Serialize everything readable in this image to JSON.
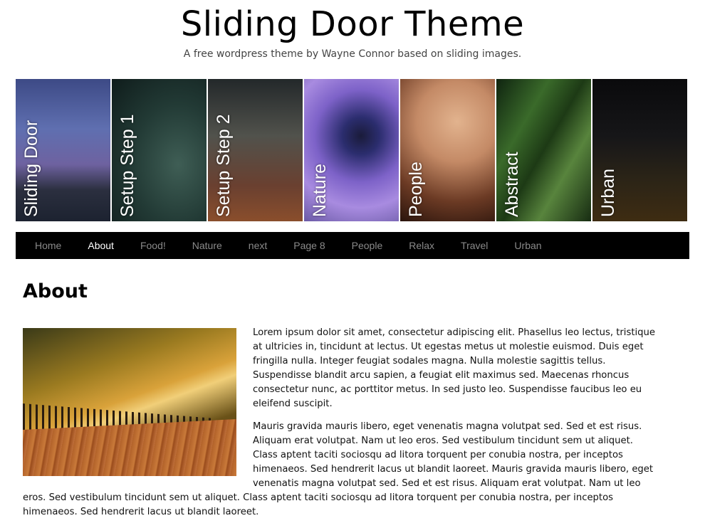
{
  "header": {
    "title": "Sliding Door Theme",
    "description": "A free wordpress theme by Wayne Connor based on sliding images."
  },
  "slider": {
    "panels": [
      {
        "label": "Sliding Door"
      },
      {
        "label": "Setup Step 1"
      },
      {
        "label": "Setup Step 2"
      },
      {
        "label": "Nature"
      },
      {
        "label": "People"
      },
      {
        "label": "Abstract"
      },
      {
        "label": "Urban"
      }
    ]
  },
  "nav": {
    "items": [
      {
        "label": "Home"
      },
      {
        "label": "About",
        "active": true
      },
      {
        "label": "Food!"
      },
      {
        "label": "Nature"
      },
      {
        "label": "next"
      },
      {
        "label": "Page 8"
      },
      {
        "label": "People"
      },
      {
        "label": "Relax"
      },
      {
        "label": "Travel"
      },
      {
        "label": "Urban"
      }
    ],
    "active_color": "#ffffff",
    "inactive_color": "#8a8a8a"
  },
  "page": {
    "title": "About",
    "paragraphs": [
      "Lorem ipsum dolor sit amet, consectetur adipiscing elit. Phasellus leo lectus, tristique at ultricies in, tincidunt at lectus. Ut egestas metus ut molestie euismod. Duis eget fringilla nulla. Integer feugiat sodales magna. Nulla molestie sagittis tellus. Suspendisse blandit arcu sapien, a feugiat elit maximus sed. Maecenas rhoncus consectetur nunc, ac porttitor metus. In sed justo leo. Suspendisse faucibus leo eu eleifend suscipit.",
      "Mauris gravida mauris libero, eget venenatis magna volutpat sed. Sed et est risus. Aliquam erat volutpat. Nam ut leo eros. Sed vestibulum tincidunt sem ut aliquet. Class aptent taciti sociosqu ad litora torquent per conubia nostra, per inceptos himenaeos. Sed hendrerit lacus ut blandit laoreet. Mauris gravida mauris libero, eget venenatis magna volutpat sed. Sed et est risus. Aliquam erat volutpat. Nam ut leo eros. Sed vestibulum tincidunt sem ut aliquet. Class aptent taciti sociosqu ad litora torquent per conubia nostra, per inceptos himenaeos. Sed hendrerit lacus ut blandit laoreet."
    ]
  }
}
